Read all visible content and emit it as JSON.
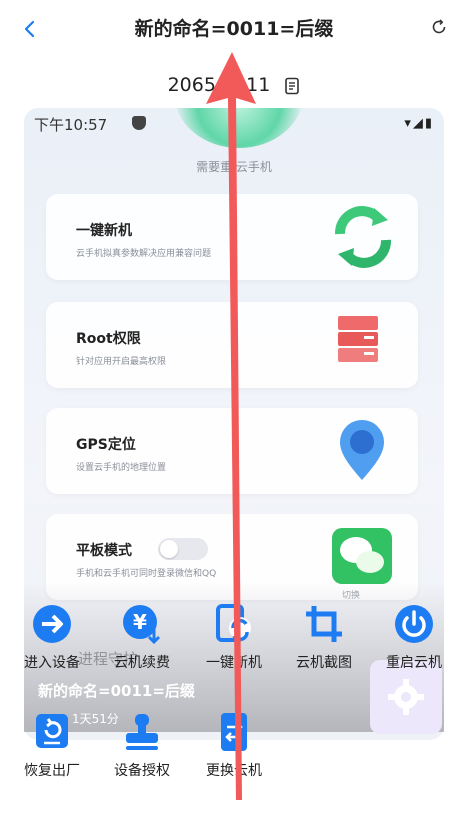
{
  "header": {
    "back_icon": "chevron-left-icon",
    "title": "新的命名=0011=后缀",
    "refresh_icon": "refresh-icon"
  },
  "device": {
    "id": "20656 811",
    "copy_icon": "copy-icon"
  },
  "phone": {
    "status_time": "下午10:57",
    "hint": "需要重 云手机",
    "cards": [
      {
        "title": "一键新机",
        "subtitle": "云手机拟真参数解决应用兼容问题",
        "icon": "refresh-arrows-icon"
      },
      {
        "title": "Root权限",
        "subtitle": "针对应用开启最高权限",
        "icon": "server-icon"
      },
      {
        "title": "GPS定位",
        "subtitle": "设置云手机的地理位置",
        "icon": "location-pin-icon"
      },
      {
        "title": "平板模式",
        "subtitle": "手机和云手机可同时登录微信和QQ",
        "icon": "wechat-icon",
        "switch_label": "切换"
      }
    ],
    "background_progress": "进程守护",
    "background_name": "新的命名=0011=后缀",
    "background_time": "1天51分"
  },
  "actions": [
    {
      "label": "进入设备",
      "icon": "enter-arrow-icon"
    },
    {
      "label": "云机续费",
      "icon": "yen-renew-icon"
    },
    {
      "label": "一键新机",
      "icon": "phone-refresh-icon"
    },
    {
      "label": "云机截图",
      "icon": "crop-icon"
    },
    {
      "label": "重启云机",
      "icon": "power-icon"
    },
    {
      "label": "恢复出厂",
      "icon": "factory-reset-icon"
    },
    {
      "label": "设备授权",
      "icon": "stamp-icon"
    },
    {
      "label": "更换云机",
      "icon": "swap-device-icon"
    }
  ],
  "colors": {
    "accent": "#1e7cf2",
    "arrow": "#f25a5a"
  }
}
